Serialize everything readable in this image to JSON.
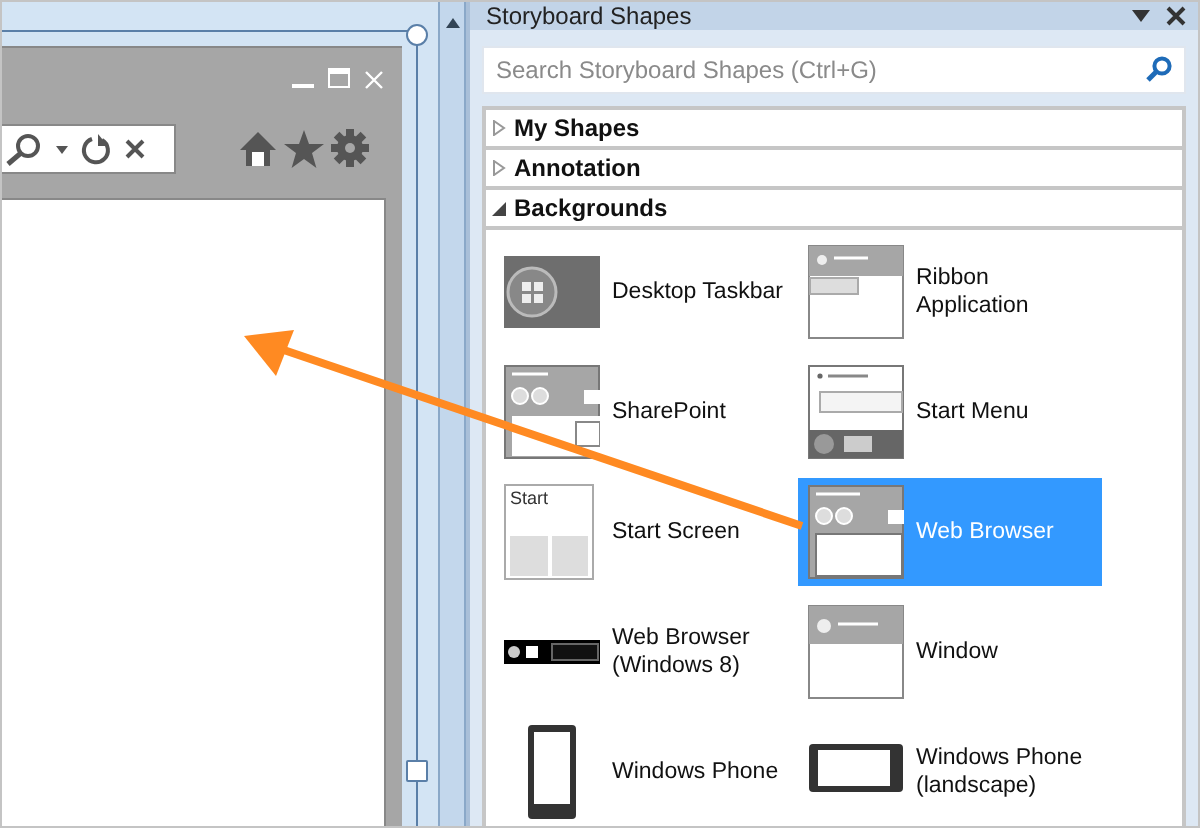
{
  "panel": {
    "title": "Storyboard Shapes",
    "search": {
      "placeholder": "Search Storyboard Shapes (Ctrl+G)"
    },
    "sections": [
      {
        "label": "My Shapes",
        "expanded": false
      },
      {
        "label": "Annotation",
        "expanded": false
      },
      {
        "label": "Backgrounds",
        "expanded": true
      }
    ],
    "items": [
      {
        "label": "Desktop Taskbar",
        "kind": "taskbar",
        "selected": false
      },
      {
        "label": "Ribbon Application",
        "kind": "ribbon",
        "selected": false
      },
      {
        "label": "SharePoint",
        "kind": "sharepoint",
        "selected": false
      },
      {
        "label": "Start Menu",
        "kind": "startmenu",
        "selected": false
      },
      {
        "label": "Start Screen",
        "kind": "startscreen",
        "thumb_text": "Start",
        "selected": false
      },
      {
        "label": "Web Browser",
        "kind": "browser",
        "selected": true
      },
      {
        "label": "Web Browser (Windows 8)",
        "kind": "win8browser",
        "selected": false
      },
      {
        "label": "Window",
        "kind": "window",
        "selected": false
      },
      {
        "label": "Windows Phone",
        "kind": "phone",
        "selected": false
      },
      {
        "label": "Windows Phone (landscape)",
        "kind": "phonelandscape",
        "selected": false
      }
    ]
  }
}
